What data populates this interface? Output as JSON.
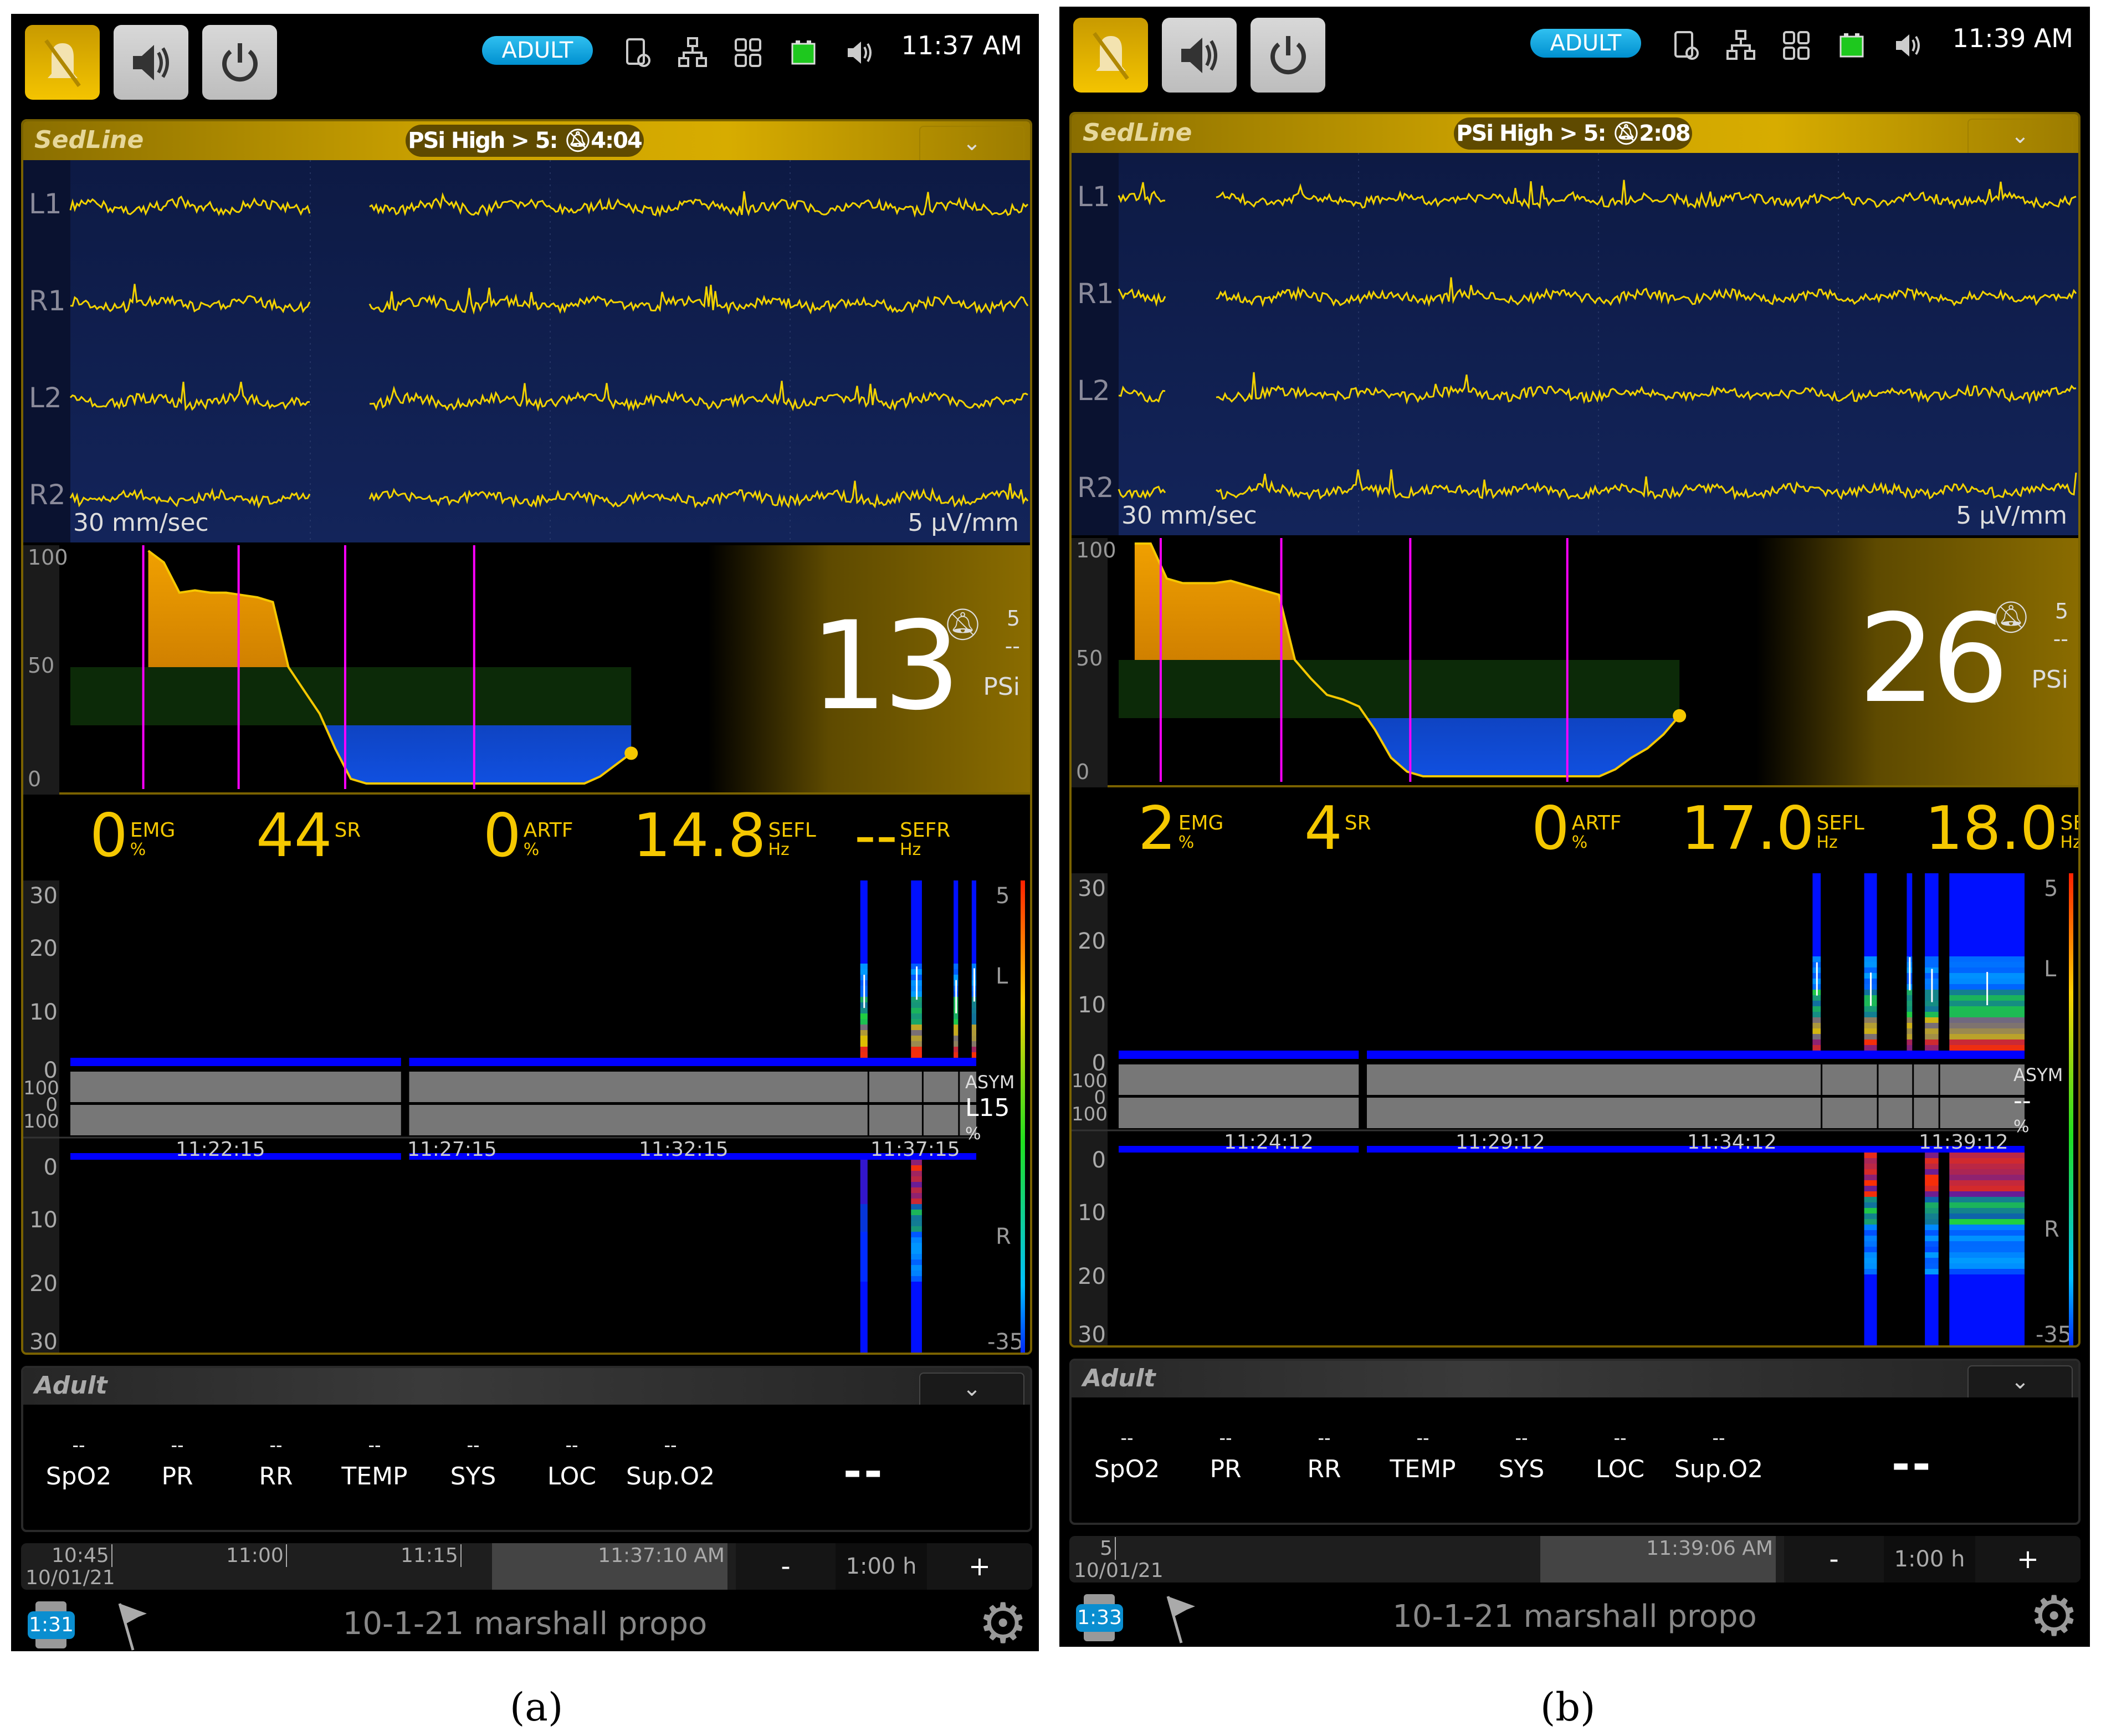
{
  "panels": [
    {
      "caption": "(a)",
      "clock": "11:37 AM",
      "mode": "ADULT",
      "sedline": {
        "title": "SedLine",
        "alarm_text": "PSi High > 5:",
        "alarm_timer": "4:04",
        "collapse_icon": "chevron-down"
      },
      "eeg": {
        "channels": [
          "L1",
          "R1",
          "L2",
          "R2"
        ],
        "speed": "30 mm/sec",
        "scale": "5 μV/mm"
      },
      "psi": {
        "value": "13",
        "y_ticks": [
          "100",
          "50",
          "0"
        ],
        "limit": "5",
        "limit_secondary": "--",
        "label": "PSi",
        "trend": [
          null,
          null,
          null,
          null,
          null,
          100,
          95,
          82,
          83,
          82,
          82,
          81,
          80,
          78,
          50,
          40,
          30,
          15,
          2,
          0,
          0,
          0,
          0,
          0,
          0,
          0,
          0,
          0,
          0,
          0,
          0,
          0,
          0,
          0,
          3,
          8,
          13
        ]
      },
      "metrics": [
        {
          "value": "0",
          "name": "EMG",
          "unit": "%"
        },
        {
          "value": "44",
          "name": "SR",
          "unit": ""
        },
        {
          "value": "0",
          "name": "ARTF",
          "unit": "%"
        },
        {
          "value": "14.8",
          "name": "SEFL",
          "unit": "Hz"
        },
        {
          "value": "--",
          "name": "SEFR",
          "unit": "Hz"
        }
      ],
      "dsa": {
        "left_ticks": [
          "30",
          "20",
          "10",
          "0"
        ],
        "asym_ticks": [
          "100",
          "0",
          "100"
        ],
        "right_ticks": [
          "0",
          "10",
          "20",
          "30"
        ],
        "time_ticks": [
          "11:22:15",
          "11:27:15",
          "11:32:15",
          "11:37:15"
        ],
        "label_left": "L",
        "label_right": "R",
        "scale_top": "5",
        "scale_bottom": "-35",
        "asym_label": "ASYM",
        "asym_value": "L15",
        "asym_unit": "%"
      },
      "params": {
        "labels": [
          "SpO2",
          "PR",
          "RR",
          "TEMP",
          "SYS",
          "LOC",
          "Sup.O2"
        ],
        "values": [
          "--",
          "--",
          "--",
          "--",
          "--",
          "--",
          "--"
        ],
        "main": "--",
        "title": "Adult"
      },
      "timeline": {
        "ticks": [
          "10:45",
          "11:00",
          "11:15"
        ],
        "date": "10/01/21",
        "current": "11:37:10 AM",
        "minus": "-",
        "zoom": "1:00 h",
        "plus": "+"
      },
      "footer": {
        "timer": "1:31",
        "case_name": "10-1-21 marshall propo"
      }
    },
    {
      "caption": "(b)",
      "clock": "11:39 AM",
      "mode": "ADULT",
      "sedline": {
        "title": "SedLine",
        "alarm_text": "PSi High > 5:",
        "alarm_timer": "2:08",
        "collapse_icon": "chevron-down"
      },
      "eeg": {
        "channels": [
          "L1",
          "R1",
          "L2",
          "R2"
        ],
        "speed": "30 mm/sec",
        "scale": "5 μV/mm"
      },
      "psi": {
        "value": "26",
        "y_ticks": [
          "100",
          "50",
          "0"
        ],
        "limit": "5",
        "limit_secondary": "--",
        "label": "PSi",
        "trend": [
          null,
          100,
          100,
          85,
          83,
          83,
          83,
          84,
          82,
          80,
          78,
          50,
          42,
          35,
          33,
          30,
          20,
          8,
          2,
          0,
          0,
          0,
          0,
          0,
          0,
          0,
          0,
          0,
          0,
          0,
          0,
          3,
          8,
          12,
          18,
          26
        ]
      },
      "metrics": [
        {
          "value": "2",
          "name": "EMG",
          "unit": "%"
        },
        {
          "value": "4",
          "name": "SR",
          "unit": ""
        },
        {
          "value": "0",
          "name": "ARTF",
          "unit": "%"
        },
        {
          "value": "17.0",
          "name": "SEFL",
          "unit": "Hz"
        },
        {
          "value": "18.0",
          "name": "SEFR",
          "unit": "Hz"
        }
      ],
      "dsa": {
        "left_ticks": [
          "30",
          "20",
          "10",
          "0"
        ],
        "asym_ticks": [
          "100",
          "0",
          "100"
        ],
        "right_ticks": [
          "0",
          "10",
          "20",
          "30"
        ],
        "time_ticks": [
          "11:24:12",
          "11:29:12",
          "11:34:12",
          "11:39:12"
        ],
        "label_left": "L",
        "label_right": "R",
        "scale_top": "5",
        "scale_bottom": "-35",
        "asym_label": "ASYM",
        "asym_value": "--",
        "asym_unit": "%"
      },
      "params": {
        "labels": [
          "SpO2",
          "PR",
          "RR",
          "TEMP",
          "SYS",
          "LOC",
          "Sup.O2"
        ],
        "values": [
          "--",
          "--",
          "--",
          "--",
          "--",
          "--",
          "--"
        ],
        "main": "--",
        "title": "Adult"
      },
      "timeline": {
        "ticks": [
          "5"
        ],
        "date": "10/01/21",
        "current": "11:39:06 AM",
        "minus": "-",
        "zoom": "1:00 h",
        "plus": "+"
      },
      "footer": {
        "timer": "1:33",
        "case_name": "10-1-21 marshall propo"
      }
    }
  ],
  "colors": {
    "accent": "#f5c800",
    "sedline_gold": "#c9a000",
    "mode_pill": "#10a8e0",
    "marker": "#ff00ff",
    "dsa_base": "#0000ff"
  }
}
